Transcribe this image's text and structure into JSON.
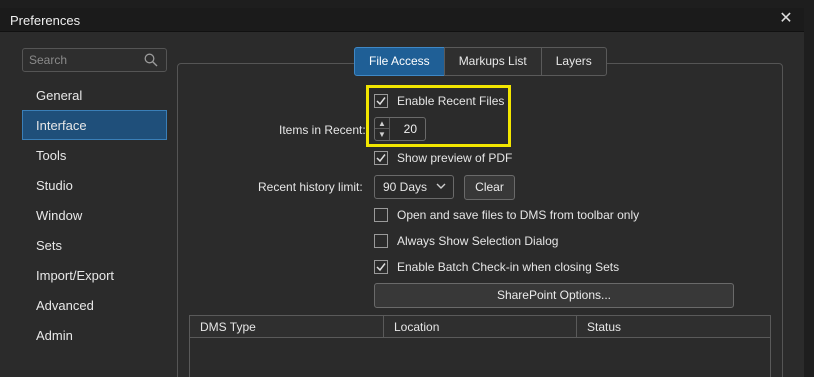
{
  "window": {
    "title": "Preferences"
  },
  "search": {
    "placeholder": "Search"
  },
  "sidebar": {
    "items": [
      {
        "label": "General"
      },
      {
        "label": "Interface",
        "active": true
      },
      {
        "label": "Tools"
      },
      {
        "label": "Studio"
      },
      {
        "label": "Window"
      },
      {
        "label": "Sets"
      },
      {
        "label": "Import/Export"
      },
      {
        "label": "Advanced"
      },
      {
        "label": "Admin"
      }
    ]
  },
  "tabs": [
    {
      "label": "File Access",
      "active": true
    },
    {
      "label": "Markups List"
    },
    {
      "label": "Layers"
    }
  ],
  "file_access": {
    "enable_recent_files": {
      "label": "Enable Recent Files",
      "checked": true
    },
    "items_in_recent": {
      "label": "Items in Recent:",
      "value": "20"
    },
    "show_preview": {
      "label": "Show preview of PDF",
      "checked": true
    },
    "recent_history": {
      "label": "Recent history limit:",
      "value": "90 Days",
      "clear_label": "Clear"
    },
    "open_save_dms": {
      "label": "Open and save files to DMS from toolbar only",
      "checked": false
    },
    "always_show_selection": {
      "label": "Always Show Selection Dialog",
      "checked": false
    },
    "enable_batch_checkin": {
      "label": "Enable Batch Check-in when closing Sets",
      "checked": true
    },
    "sharepoint_button": "SharePoint Options...",
    "table": {
      "columns": [
        "DMS Type",
        "Location",
        "Status"
      ]
    }
  },
  "colors": {
    "accent": "#1f5f96",
    "highlight": "#f2e600",
    "active_sidebar": "#1f4f7a"
  }
}
